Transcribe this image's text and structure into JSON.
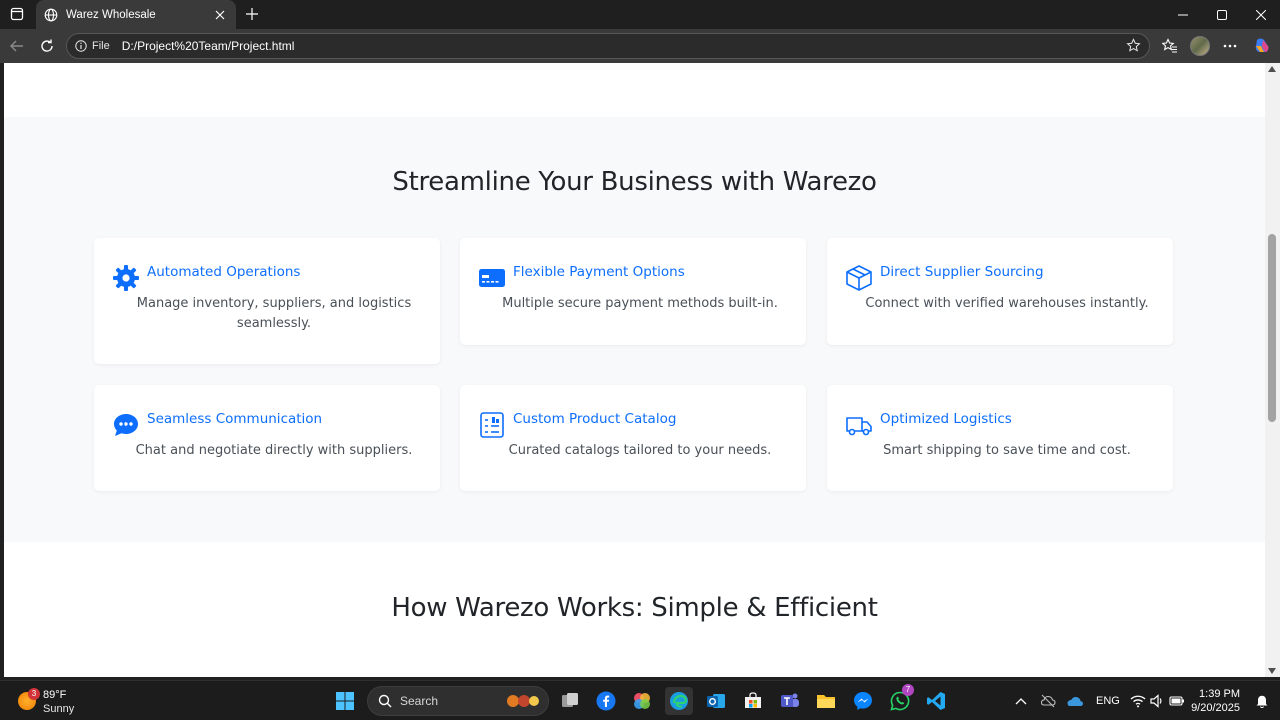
{
  "browser": {
    "tab_title": "Warez Wholesale",
    "omnibox_file_label": "File",
    "url": "D:/Project%20Team/Project.html"
  },
  "page": {
    "features_heading": "Streamline Your Business with Warezo",
    "features": [
      {
        "title": "Automated Operations",
        "text": "Manage inventory, suppliers, and logistics seamlessly.",
        "icon": "gear-icon"
      },
      {
        "title": "Flexible Payment Options",
        "text": "Multiple secure payment methods built-in.",
        "icon": "credit-card-icon"
      },
      {
        "title": "Direct Supplier Sourcing",
        "text": "Connect with verified warehouses instantly.",
        "icon": "box-icon"
      },
      {
        "title": "Seamless Communication",
        "text": "Chat and negotiate directly with suppliers.",
        "icon": "chat-icon"
      },
      {
        "title": "Custom Product Catalog",
        "text": "Curated catalogs tailored to your needs.",
        "icon": "catalog-icon"
      },
      {
        "title": "Optimized Logistics",
        "text": "Smart shipping to save time and cost.",
        "icon": "truck-icon"
      }
    ],
    "how_heading": "How Warezo Works: Simple & Efficient"
  },
  "taskbar": {
    "weather_temp": "89°F",
    "weather_condition": "Sunny",
    "weather_badge": "3",
    "search_placeholder": "Search",
    "whatsapp_badge": "7",
    "language": "ENG",
    "time": "1:39 PM",
    "date": "9/20/2025"
  },
  "colors": {
    "accent": "#0d6efd",
    "section_bg": "#f8f9fa"
  }
}
